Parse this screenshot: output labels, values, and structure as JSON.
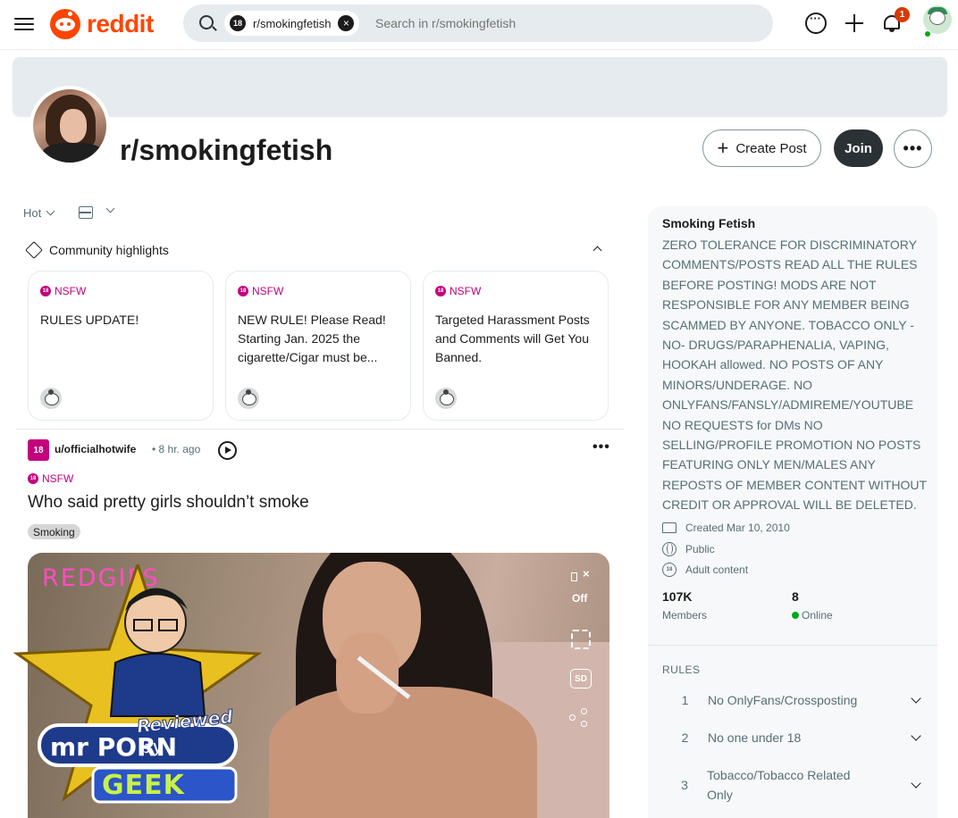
{
  "header": {
    "logo_text": "reddit",
    "search_chip": "r/smokingfetish",
    "search_chip_badge": "18",
    "search_placeholder": "Search in r/smokingfetish",
    "notification_count": "1"
  },
  "subreddit": {
    "name": "r/smokingfetish",
    "create_post_label": "Create Post",
    "join_label": "Join",
    "more_label": "•••"
  },
  "sort": {
    "label": "Hot"
  },
  "highlights": {
    "heading": "Community highlights",
    "cards": [
      {
        "tag": "NSFW",
        "title": "RULES UPDATE!"
      },
      {
        "tag": "NSFW",
        "title": "NEW RULE! Please Read! Starting Jan. 2025 the cigarette/Cigar must be..."
      },
      {
        "tag": "NSFW",
        "title": "Targeted Harassment Posts and Comments will Get You Banned."
      }
    ]
  },
  "post": {
    "avatar_label": "18",
    "username": "u/officialhotwife",
    "time": "• 8 hr. ago",
    "more_label": "•••",
    "tag": "NSFW",
    "title": "Who said pretty girls shouldn’t smoke",
    "flair": "Smoking",
    "media_brand": "REDGIFS",
    "mute_label": "Off",
    "quality_label": "SD"
  },
  "watermark": {
    "line1": "Reviewed by",
    "line2": "mr PORN",
    "line3": "GEEK"
  },
  "sidebar": {
    "title": "Smoking Fetish",
    "description": "ZERO TOLERANCE FOR DISCRIMINATORY COMMENTS/POSTS READ ALL THE RULES BEFORE POSTING! MODS ARE NOT RESPONSIBLE FOR ANY MEMBER BEING SCAMMED BY ANYONE. TOBACCO ONLY - NO- DRUGS/PARAPHENALIA, VAPING, HOOKAH allowed. NO POSTS OF ANY MINORS/UNDERAGE. NO ONLYFANS/FANSLY/ADMIREME/YOUTUBE NO REQUESTS for DMs NO SELLING/PROFILE PROMOTION NO POSTS FEATURING ONLY MEN/MALES ANY REPOSTS OF MEMBER CONTENT WITHOUT CREDIT OR APPROVAL WILL BE DELETED.",
    "created": "Created Mar 10, 2010",
    "visibility": "Public",
    "content_type": "Adult content",
    "adult_badge": "18",
    "members_count": "107K",
    "members_label": "Members",
    "online_count": "8",
    "online_label": "Online",
    "rules_heading": "RULES",
    "rules": [
      {
        "num": "1",
        "text": "No OnlyFans/Crossposting"
      },
      {
        "num": "2",
        "text": "No one under 18"
      },
      {
        "num": "3",
        "text": "Tobacco/Tobacco Related Only"
      }
    ]
  },
  "colors": {
    "brand": "#ff4500",
    "nsfw": "#c4007d",
    "join_bg": "#2a3236",
    "online": "#01a816"
  }
}
